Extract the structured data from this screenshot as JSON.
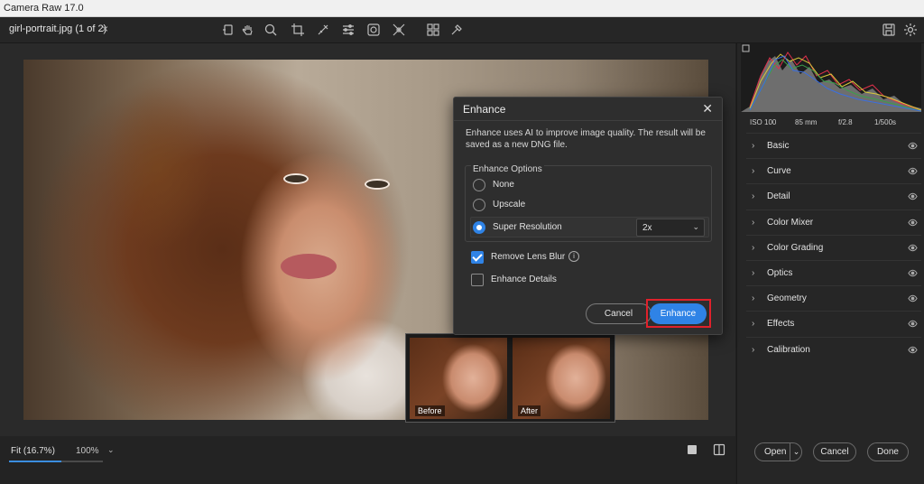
{
  "window": {
    "title": "Camera Raw 17.0"
  },
  "file_tab": {
    "name": "girl-portrait.jpg",
    "counter": "(1 of 2)",
    "close": "×"
  },
  "toolbar_icons": [
    "rotate-icon",
    "hand-icon",
    "zoom-icon",
    "crop-icon",
    "spot-heal-icon",
    "adjust-icon",
    "mask-icon",
    "redeye-icon",
    "presets-icon",
    "eyedropper-icon"
  ],
  "statusbar": {
    "fit_label": "Fit (16.7%)",
    "zoom_label": "100%",
    "zoom_fill_fraction": 0.55
  },
  "compare": {
    "before": "Before",
    "after": "After"
  },
  "exif": {
    "iso": "ISO 100",
    "focal": "85 mm",
    "aperture": "f/2.8",
    "shutter": "1/500s"
  },
  "sections": [
    {
      "label": "Basic"
    },
    {
      "label": "Curve"
    },
    {
      "label": "Detail"
    },
    {
      "label": "Color Mixer"
    },
    {
      "label": "Color Grading"
    },
    {
      "label": "Optics"
    },
    {
      "label": "Geometry"
    },
    {
      "label": "Effects"
    },
    {
      "label": "Calibration"
    }
  ],
  "footer": {
    "open": "Open",
    "cancel": "Cancel",
    "done": "Done"
  },
  "dialog": {
    "title": "Enhance",
    "close": "✕",
    "description": "Enhance uses AI to improve image quality. The result will be saved as a new DNG file.",
    "options_legend": "Enhance Options",
    "options": [
      {
        "label": "None",
        "selected": false
      },
      {
        "label": "Upscale",
        "selected": false
      },
      {
        "label": "Super Resolution",
        "selected": true
      }
    ],
    "scale": "2x",
    "remove_lens_blur": {
      "label": "Remove Lens Blur",
      "checked": true
    },
    "enhance_details": {
      "label": "Enhance Details",
      "checked": false
    },
    "cancel": "Cancel",
    "enhance": "Enhance"
  },
  "colors": {
    "accent": "#2f83e6",
    "highlight": "#e0212b"
  }
}
